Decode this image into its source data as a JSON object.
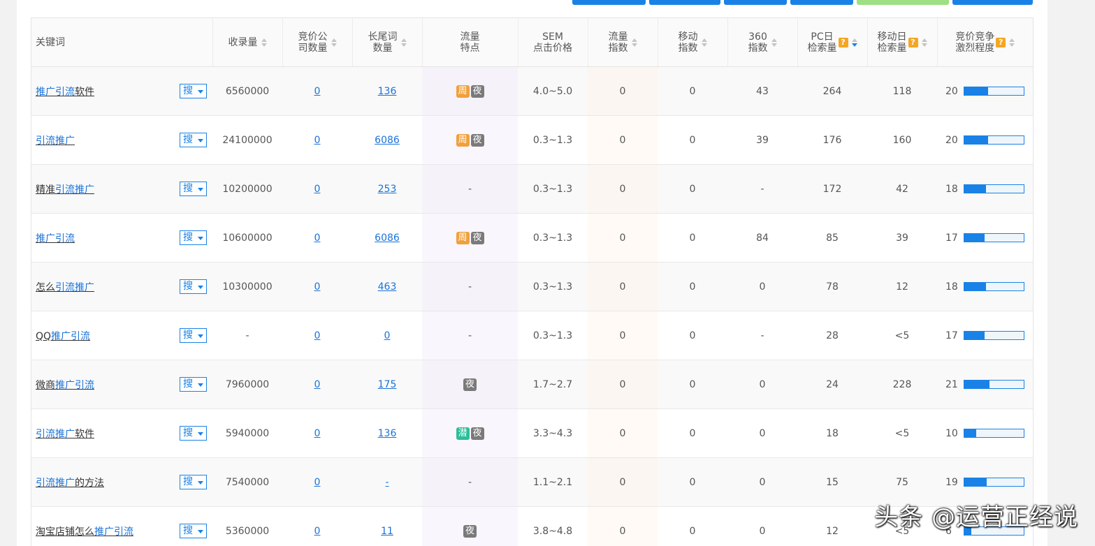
{
  "columns": {
    "keyword": "关键词",
    "indexed": "收录量",
    "bid_companies_1": "竞价公",
    "bid_companies_2": "司数量",
    "longtail_1": "长尾词",
    "longtail_2": "数量",
    "traffic_feat_1": "流量",
    "traffic_feat_2": "特点",
    "sem_1": "SEM",
    "sem_2": "点击价格",
    "flow_index_1": "流量",
    "flow_index_2": "指数",
    "mobile_index_1": "移动",
    "mobile_index_2": "指数",
    "idx360_1": "360",
    "idx360_2": "指数",
    "pc_daily_1": "PC日",
    "pc_daily_2": "检索量",
    "mobile_daily_1": "移动日",
    "mobile_daily_2": "检索量",
    "competition_1": "竞价竞争",
    "competition_2": "激烈程度",
    "help_glyph": "?"
  },
  "search_label": "搜",
  "tags": {
    "week": "周",
    "night": "夜",
    "latent": "潜"
  },
  "rows": [
    {
      "kw": [
        {
          "t": "推广引流",
          "hl": true
        },
        {
          "t": "软件",
          "hl": false
        }
      ],
      "indexed": "6560000",
      "bid": "0",
      "longtail": "136",
      "tags": [
        "week",
        "night"
      ],
      "sem": "4.0~5.0",
      "flow": "0",
      "mobile": "0",
      "i360": "43",
      "pc": "264",
      "mday": "118",
      "comp": "20",
      "comp_pct": 0.4
    },
    {
      "kw": [
        {
          "t": "引流推广",
          "hl": true
        }
      ],
      "indexed": "24100000",
      "bid": "0",
      "longtail": "6086",
      "tags": [
        "week",
        "night"
      ],
      "sem": "0.3~1.3",
      "flow": "0",
      "mobile": "0",
      "i360": "39",
      "pc": "176",
      "mday": "160",
      "comp": "20",
      "comp_pct": 0.4
    },
    {
      "kw": [
        {
          "t": "精准",
          "hl": false
        },
        {
          "t": "引流推广",
          "hl": true
        }
      ],
      "indexed": "10200000",
      "bid": "0",
      "longtail": "253",
      "tags": [],
      "feat_text": "-",
      "sem": "0.3~1.3",
      "flow": "0",
      "mobile": "0",
      "i360": "-",
      "pc": "172",
      "mday": "42",
      "comp": "18",
      "comp_pct": 0.36
    },
    {
      "kw": [
        {
          "t": "推广引流",
          "hl": true
        }
      ],
      "indexed": "10600000",
      "bid": "0",
      "longtail": "6086",
      "tags": [
        "week",
        "night"
      ],
      "sem": "0.3~1.3",
      "flow": "0",
      "mobile": "0",
      "i360": "84",
      "pc": "85",
      "mday": "39",
      "comp": "17",
      "comp_pct": 0.34
    },
    {
      "kw": [
        {
          "t": "怎么",
          "hl": false
        },
        {
          "t": "引流推广",
          "hl": true
        }
      ],
      "indexed": "10300000",
      "bid": "0",
      "longtail": "463",
      "tags": [],
      "feat_text": "-",
      "sem": "0.3~1.3",
      "flow": "0",
      "mobile": "0",
      "i360": "0",
      "pc": "78",
      "mday": "12",
      "comp": "18",
      "comp_pct": 0.36
    },
    {
      "kw": [
        {
          "t": "QQ",
          "hl": false
        },
        {
          "t": "推广引流",
          "hl": true
        }
      ],
      "indexed": "-",
      "bid": "0",
      "longtail": "0",
      "tags": [],
      "feat_text": "-",
      "sem": "0.3~1.3",
      "flow": "0",
      "mobile": "0",
      "i360": "-",
      "pc": "28",
      "mday": "<5",
      "comp": "17",
      "comp_pct": 0.34
    },
    {
      "kw": [
        {
          "t": "微商",
          "hl": false
        },
        {
          "t": "推广引流",
          "hl": true
        }
      ],
      "indexed": "7960000",
      "bid": "0",
      "longtail": "175",
      "tags": [
        "night"
      ],
      "sem": "1.7~2.7",
      "flow": "0",
      "mobile": "0",
      "i360": "0",
      "pc": "24",
      "mday": "228",
      "comp": "21",
      "comp_pct": 0.42
    },
    {
      "kw": [
        {
          "t": "引流推广",
          "hl": true
        },
        {
          "t": "软件",
          "hl": false
        }
      ],
      "indexed": "5940000",
      "bid": "0",
      "longtail": "136",
      "tags": [
        "latent",
        "night"
      ],
      "sem": "3.3~4.3",
      "flow": "0",
      "mobile": "0",
      "i360": "0",
      "pc": "18",
      "mday": "<5",
      "comp": "10",
      "comp_pct": 0.2
    },
    {
      "kw": [
        {
          "t": "引流推广",
          "hl": true
        },
        {
          "t": "的方法",
          "hl": false
        }
      ],
      "indexed": "7540000",
      "bid": "0",
      "longtail": "-",
      "tags": [],
      "feat_text": "-",
      "sem": "1.1~2.1",
      "flow": "0",
      "mobile": "0",
      "i360": "0",
      "pc": "15",
      "mday": "75",
      "comp": "19",
      "comp_pct": 0.38
    },
    {
      "kw": [
        {
          "t": "淘宝店铺怎么",
          "hl": false
        },
        {
          "t": "推广引流",
          "hl": true
        }
      ],
      "indexed": "5360000",
      "bid": "0",
      "longtail": "11",
      "tags": [
        "night"
      ],
      "sem": "3.8~4.8",
      "flow": "0",
      "mobile": "0",
      "i360": "0",
      "pc": "12",
      "mday": "<5",
      "comp": "6",
      "comp_pct": 0.12
    }
  ],
  "watermark": "头条 @运营正经说",
  "colors": {
    "accent": "#1a82e6",
    "tag_week": "#f0a03c",
    "tag_night": "#7a7a7a",
    "tag_latent": "#2bbf99",
    "help": "#f5a623"
  }
}
